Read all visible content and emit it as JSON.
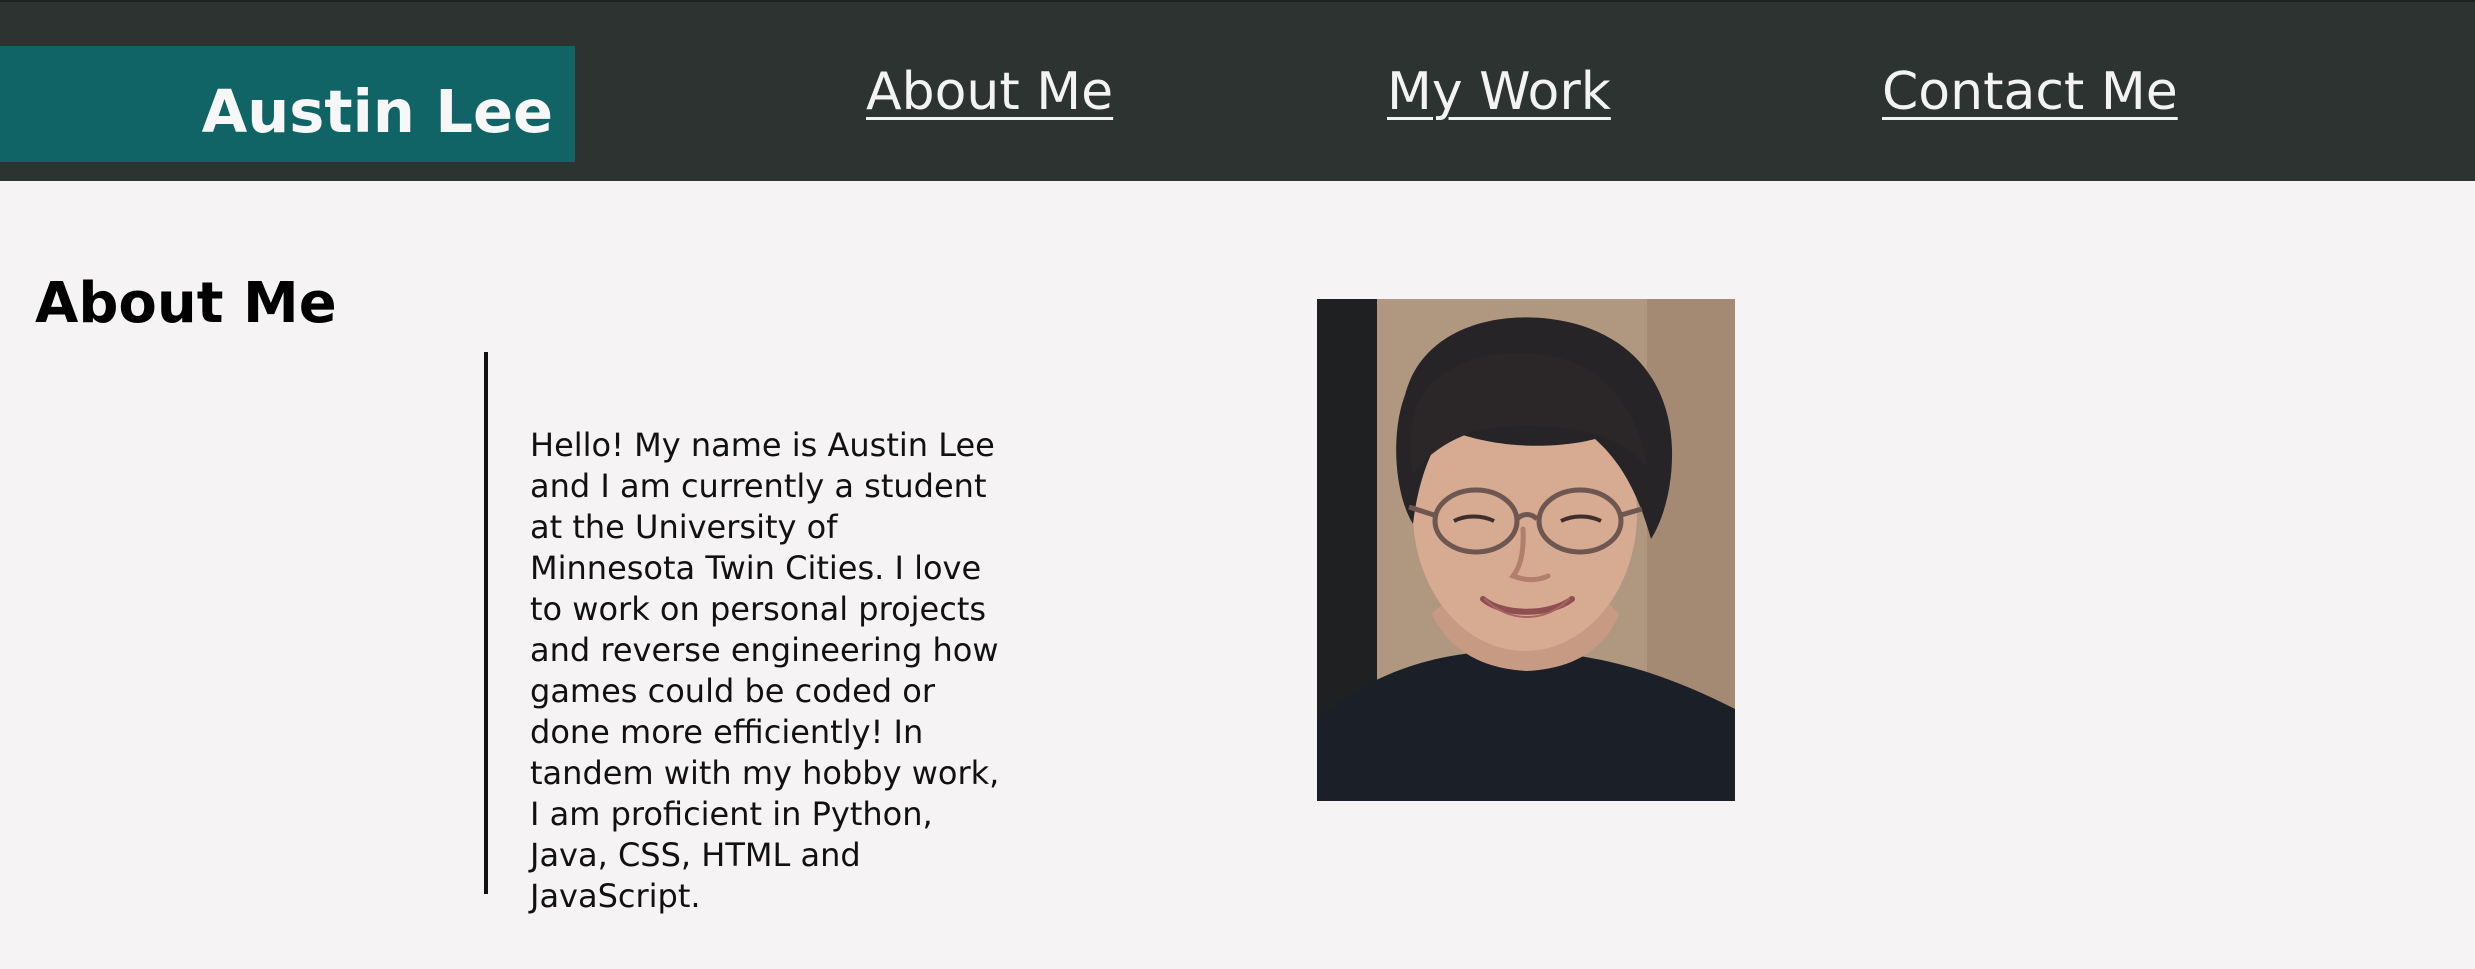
{
  "header": {
    "brand_name": "Austin Lee",
    "nav": {
      "about": "About Me",
      "work": "My Work",
      "contact": "Contact Me"
    }
  },
  "about": {
    "title": "About Me",
    "bio": "Hello! My name is Austin Lee and I am currently a student at the University of Minnesota Twin Cities. I love to work on personal projects and reverse engineering how games could be coded or done more efficiently! In tandem with my hobby work, I am proficient in Python, Java, CSS, HTML and JavaScript.",
    "photo_icon": "portrait-photo"
  },
  "colors": {
    "header_bg": "#2c3331",
    "brand_bg": "#106466",
    "page_bg": "#f5f3f4",
    "nav_text": "#f3f3f3"
  }
}
